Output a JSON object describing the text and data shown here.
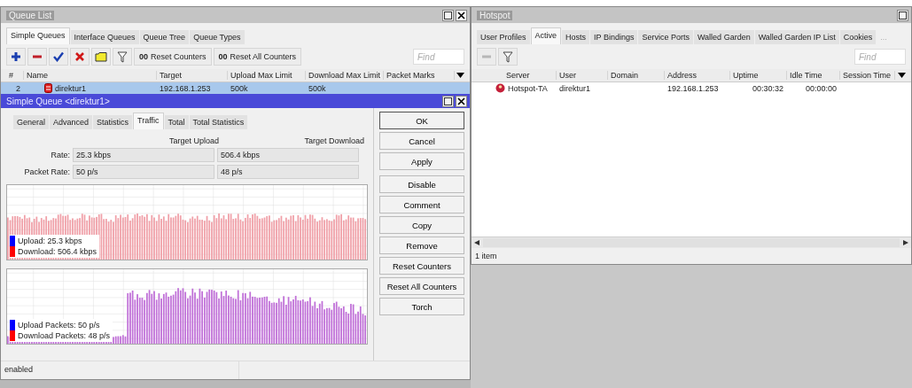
{
  "queue_list": {
    "title": "Queue List",
    "tabs": [
      {
        "label": "Simple Queues",
        "selected": true
      },
      {
        "label": "Interface Queues",
        "selected": false
      },
      {
        "label": "Queue Tree",
        "selected": false
      },
      {
        "label": "Queue Types",
        "selected": false
      }
    ],
    "toolbar": {
      "counter_buttons": [
        {
          "icon_text": "00",
          "label": "Reset Counters"
        },
        {
          "icon_text": "00",
          "label": "Reset All Counters"
        }
      ],
      "find_placeholder": "Find"
    },
    "columns": [
      "#",
      "Name",
      "Target",
      "Upload Max Limit",
      "Download Max Limit",
      "Packet Marks"
    ],
    "rows": [
      {
        "selected": true,
        "cells": [
          "2",
          "direktur1",
          "192.168.1.253",
          "500k",
          "500k",
          ""
        ]
      }
    ]
  },
  "simple_queue": {
    "title": "Simple Queue <direktur1>",
    "tabs": [
      {
        "label": "General",
        "selected": false
      },
      {
        "label": "Advanced",
        "selected": false
      },
      {
        "label": "Statistics",
        "selected": false
      },
      {
        "label": "Traffic",
        "selected": true
      },
      {
        "label": "Total",
        "selected": false
      },
      {
        "label": "Total Statistics",
        "selected": false
      }
    ],
    "headers": [
      "Target Upload",
      "Target Download"
    ],
    "fields": [
      {
        "label": "Rate:",
        "upload": "25.3 kbps",
        "download": "506.4 kbps"
      },
      {
        "label": "Packet Rate:",
        "upload": "50 p/s",
        "download": "48 p/s"
      }
    ],
    "graphs": [
      {
        "legend": [
          {
            "label": "Upload:  25.3 kbps",
            "color": "#0000ff"
          },
          {
            "label": "Download:  506.4 kbps",
            "color": "#ff0000"
          }
        ]
      },
      {
        "legend": [
          {
            "label": "Upload Packets:  50 p/s",
            "color": "#0000ff"
          },
          {
            "label": "Download Packets:  48 p/s",
            "color": "#ff0000"
          }
        ]
      }
    ],
    "buttons": [
      "OK",
      "Cancel",
      "Apply",
      "Disable",
      "Comment",
      "Copy",
      "Remove",
      "Reset Counters",
      "Reset All Counters",
      "Torch"
    ],
    "status": "enabled"
  },
  "hotspot": {
    "title": "Hotspot",
    "tabs": [
      {
        "label": "User Profiles",
        "selected": false
      },
      {
        "label": "Active",
        "selected": true
      },
      {
        "label": "Hosts",
        "selected": false
      },
      {
        "label": "IP Bindings",
        "selected": false
      },
      {
        "label": "Service Ports",
        "selected": false
      },
      {
        "label": "Walled Garden",
        "selected": false
      },
      {
        "label": "Walled Garden IP List",
        "selected": false
      },
      {
        "label": "Cookies",
        "selected": false
      }
    ],
    "more_tabs": "...",
    "find_placeholder": "Find",
    "columns": [
      "Server",
      "User",
      "Domain",
      "Address",
      "Uptime",
      "Idle Time",
      "Session Time"
    ],
    "rows": [
      {
        "selected": false,
        "cells": [
          "Hotspot-TA",
          "direktur1",
          "",
          "192.168.1.253",
          "00:30:32",
          "00:00:00",
          ""
        ]
      }
    ],
    "status": "1 item"
  }
}
